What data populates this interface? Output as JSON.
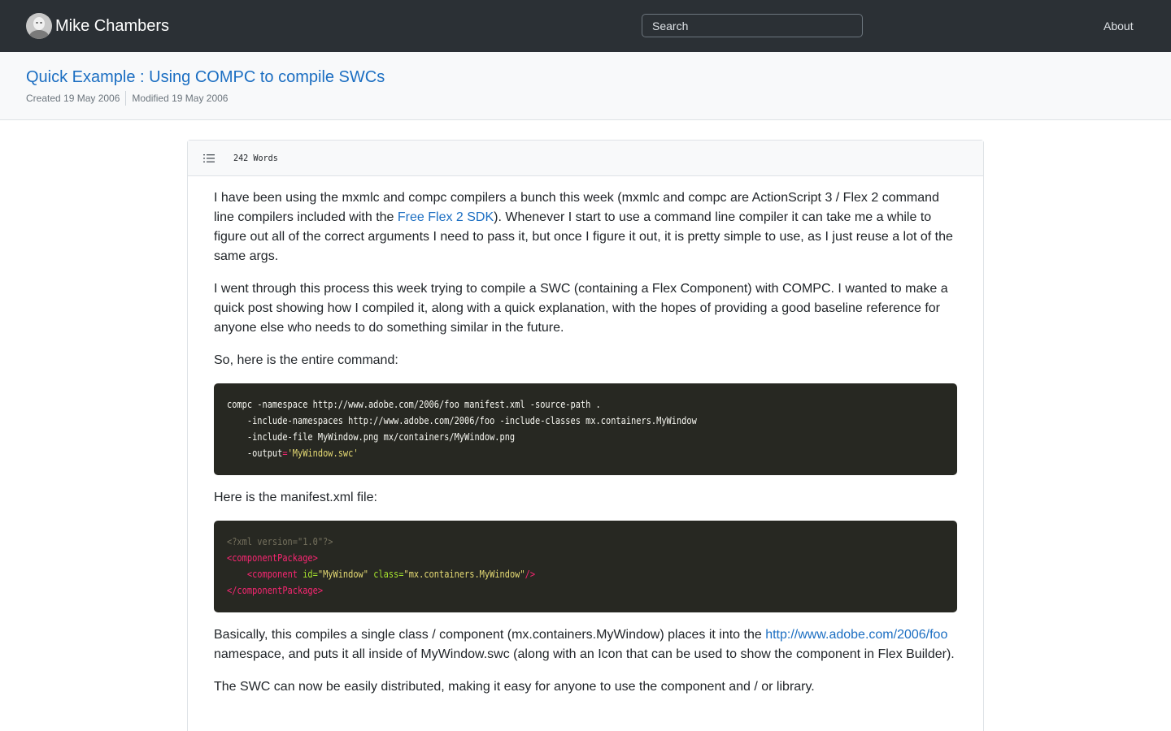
{
  "navbar": {
    "brand_name": "Mike Chambers",
    "avatar_icon": "avatar-photo",
    "search_placeholder": "Search",
    "about_label": "About",
    "background": "#2b3035"
  },
  "post": {
    "title": "Quick Example : Using COMPC to compile SWCs",
    "created": "Created 19 May 2006",
    "modified": "Modified 19 May 2006"
  },
  "card": {
    "toc_icon": "list-icon",
    "word_count": "242 Words"
  },
  "content": {
    "p1_a": "I have been using the mxmlc and compc compilers a bunch this week (mxmlc and compc are ActionScript 3 / Flex 2 command line compilers included with the ",
    "p1_link": "Free Flex 2 SDK",
    "p1_b": "). Whenever I start to use a command line compiler it can take me a while to figure out all of the correct arguments I need to pass it, but once I figure it out, it is pretty simple to use, as I just reuse a lot of the same args.",
    "p2": "I went through this process this week trying to compile a SWC (containing a Flex Component) with COMPC. I wanted to make a quick post showing how I compiled it, along with a quick explanation, with the hopes of providing a good baseline reference for anyone else who needs to do something similar in the future.",
    "p3": "So, here is the entire command:",
    "code1": {
      "line1": "compc -namespace http://www.adobe.com/2006/foo manifest.xml -source-path .",
      "line2": "    -include-namespaces http://www.adobe.com/2006/foo -include-classes mx.containers.MyWindow",
      "line3": "    -include-file MyWindow.png mx/containers/MyWindow.png",
      "line4_a": "    -output",
      "line4_op": "=",
      "line4_str": "'MyWindow.swc'"
    },
    "p4": "Here is the manifest.xml file:",
    "code2": {
      "line1": "<?xml version=\"1.0\"?>",
      "line2": "<componentPackage>",
      "line3_indent": "    ",
      "line3_tag": "<component",
      "line3_attr1": " id=",
      "line3_val1": "\"MyWindow\"",
      "line3_attr2": " class=",
      "line3_val2": "\"mx.containers.MyWindow\"",
      "line3_close": "/>",
      "line4": "</componentPackage>"
    },
    "p5_a": "Basically, this compiles a single class / component (mx.containers.MyWindow) places it into the ",
    "p5_link": "http://www.adobe.com/2006/foo",
    "p5_b": " namespace, and puts it all inside of MyWindow.swc (along with an Icon that can be used to show the component in Flex Builder).",
    "p6": "The SWC can now be easily distributed, making it easy for anyone to use the component and / or library."
  }
}
